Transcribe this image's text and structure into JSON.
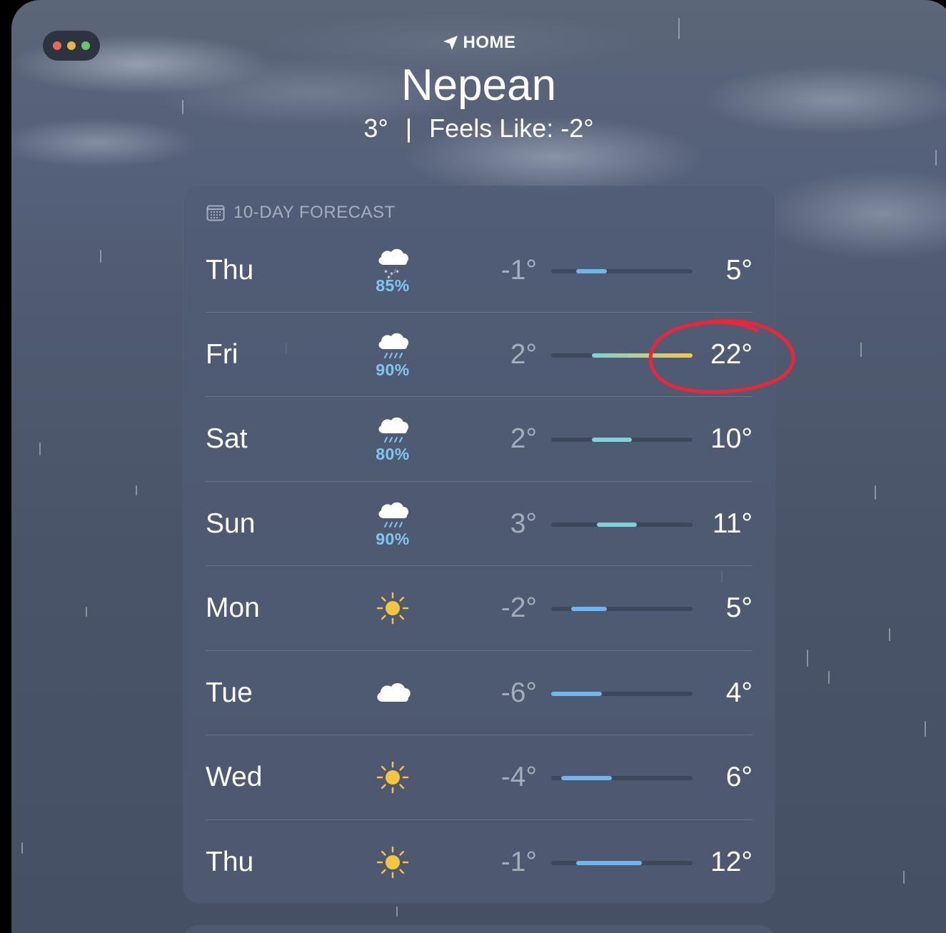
{
  "window": {
    "traffic_lights": {
      "close_color": "#e46a5e",
      "minimize_color": "#e0b74a",
      "zoom_color": "#6cc46a"
    }
  },
  "header": {
    "location_label": "HOME",
    "location_icon": "location-arrow-icon",
    "city": "Nepean",
    "current_temp": "3°",
    "separator": "|",
    "feels_like": "Feels Like: -2°"
  },
  "forecast": {
    "title": "10-DAY FORECAST",
    "title_icon": "calendar-icon",
    "days": [
      {
        "day": "Thu",
        "icon": "snow-icon",
        "precip": "85%",
        "low": "-1°",
        "high": "5°"
      },
      {
        "day": "Fri",
        "icon": "rain-icon",
        "precip": "90%",
        "low": "2°",
        "high": "22°"
      },
      {
        "day": "Sat",
        "icon": "rain-icon",
        "precip": "80%",
        "low": "2°",
        "high": "10°"
      },
      {
        "day": "Sun",
        "icon": "rain-icon",
        "precip": "90%",
        "low": "3°",
        "high": "11°"
      },
      {
        "day": "Mon",
        "icon": "sun-icon",
        "precip": "",
        "low": "-2°",
        "high": "5°"
      },
      {
        "day": "Tue",
        "icon": "cloud-icon",
        "precip": "",
        "low": "-6°",
        "high": "4°"
      },
      {
        "day": "Wed",
        "icon": "sun-icon",
        "precip": "",
        "low": "-4°",
        "high": "6°"
      },
      {
        "day": "Thu",
        "icon": "sun-icon",
        "precip": "",
        "low": "-1°",
        "high": "12°"
      }
    ],
    "range": {
      "min": -6,
      "max": 22
    },
    "values": [
      {
        "low": -1,
        "high": 5
      },
      {
        "low": 2,
        "high": 22
      },
      {
        "low": 2,
        "high": 10
      },
      {
        "low": 3,
        "high": 11
      },
      {
        "low": -2,
        "high": 5
      },
      {
        "low": -6,
        "high": 4
      },
      {
        "low": -4,
        "high": 6
      },
      {
        "low": -1,
        "high": 12
      }
    ],
    "colors": {
      "cold": "#6db6f0",
      "mild": "#7fd0d8",
      "warm": "#f2c94c",
      "precip": "#7cc7f2",
      "sun": "#f5c542"
    }
  },
  "annotation": {
    "color": "#e8283a",
    "target": "Fri high 22°"
  }
}
